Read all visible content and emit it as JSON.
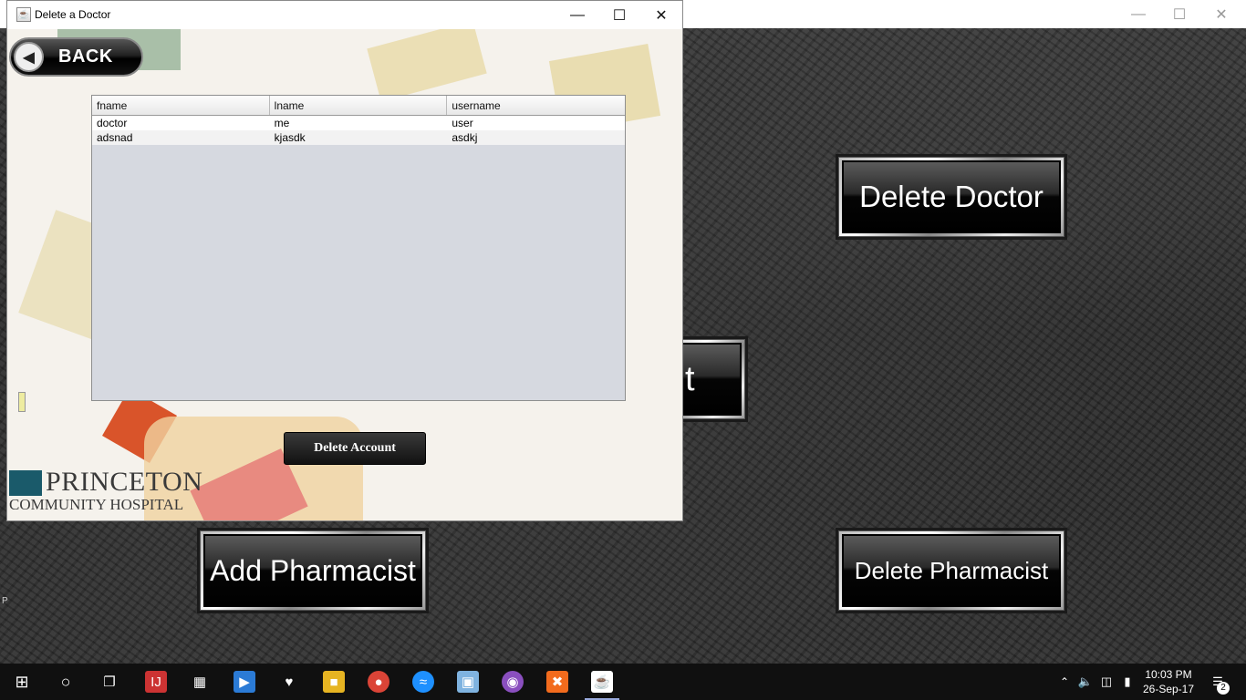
{
  "dialog": {
    "title": "Delete a Doctor",
    "back_label": "BACK",
    "table": {
      "columns": [
        "fname",
        "lname",
        "username"
      ],
      "rows": [
        [
          "doctor",
          "me",
          "user"
        ],
        [
          "adsnad",
          "kjasdk",
          "asdkj"
        ]
      ]
    },
    "delete_label": "Delete Account",
    "logo": {
      "name": "PRINCETON",
      "sub": "COMMUNITY HOSPITAL"
    }
  },
  "background": {
    "buttons": {
      "delete_doctor": "Delete Doctor",
      "partial": "t",
      "add_pharmacist": "Add Pharmacist",
      "delete_pharmacist": "Delete Pharmacist"
    },
    "left_edge_letter": "P"
  },
  "taskbar": {
    "time": "10:03 PM",
    "date": "26-Sep-17",
    "notification_count": "2"
  }
}
